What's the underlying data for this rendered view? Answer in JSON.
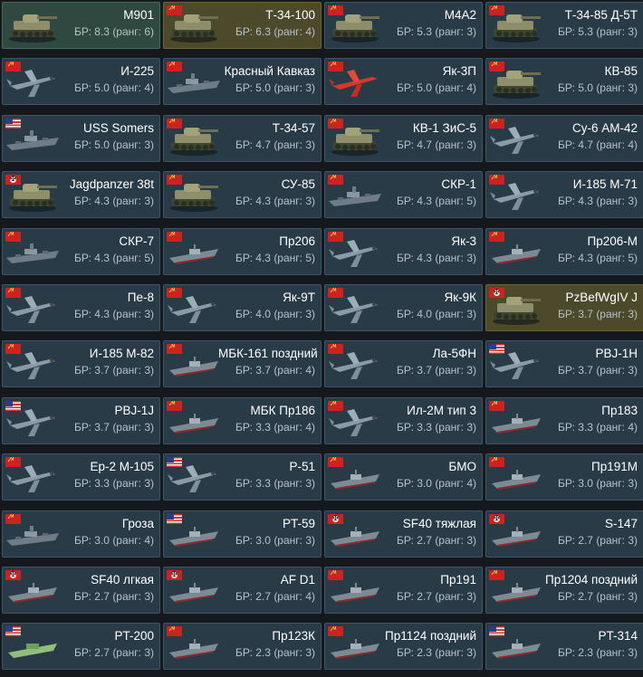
{
  "colors": {
    "normal": "#2a3b48",
    "premium": "#4d4a2b",
    "collectible": "#2f4840"
  },
  "vehicles": [
    {
      "name": "M901",
      "br": "БР: 8.3 (ранг: 6)",
      "nation": "none",
      "type": "tank",
      "variant": "collect",
      "icon": "tank-icon"
    },
    {
      "name": "Т-34-100",
      "br": "БР: 6.3 (ранг: 4)",
      "nation": "ussr",
      "type": "tank",
      "variant": "premium",
      "icon": "tank-icon"
    },
    {
      "name": "M4A2",
      "br": "БР: 5.3 (ранг: 3)",
      "nation": "ussr",
      "type": "tank",
      "variant": "normal",
      "icon": "tank-icon"
    },
    {
      "name": "Т-34-85 Д-5Т",
      "br": "БР: 5.3 (ранг: 3)",
      "nation": "ussr",
      "type": "tank",
      "variant": "normal",
      "icon": "tank-icon"
    },
    {
      "name": "И-225",
      "br": "БР: 5.0 (ранг: 4)",
      "nation": "ussr",
      "type": "plane",
      "variant": "normal",
      "icon": "plane-icon"
    },
    {
      "name": "Красный Кавказ",
      "br": "БР: 5.0 (ранг: 3)",
      "nation": "ussr",
      "type": "ship",
      "variant": "normal",
      "icon": "ship-icon"
    },
    {
      "name": "Як-3П",
      "br": "БР: 5.0 (ранг: 4)",
      "nation": "ussr",
      "type": "plane-red",
      "variant": "normal",
      "icon": "plane-icon"
    },
    {
      "name": "КВ-85",
      "br": "БР: 5.0 (ранг: 3)",
      "nation": "ussr",
      "type": "tank",
      "variant": "normal",
      "icon": "tank-icon"
    },
    {
      "name": "USS Somers",
      "br": "БР: 5.0 (ранг: 3)",
      "nation": "usa",
      "type": "ship",
      "variant": "normal",
      "icon": "ship-icon"
    },
    {
      "name": "Т-34-57",
      "br": "БР: 4.7 (ранг: 3)",
      "nation": "ussr",
      "type": "tank",
      "variant": "normal",
      "icon": "tank-icon"
    },
    {
      "name": "КВ-1 ЗиС-5",
      "br": "БР: 4.7 (ранг: 3)",
      "nation": "ussr",
      "type": "tank",
      "variant": "normal",
      "icon": "tank-icon"
    },
    {
      "name": "Су-6 АМ-42",
      "br": "БР: 4.7 (ранг: 4)",
      "nation": "ussr",
      "type": "plane",
      "variant": "normal",
      "icon": "plane-icon"
    },
    {
      "name": "Jagdpanzer 38t",
      "br": "БР: 4.3 (ранг: 3)",
      "nation": "ger",
      "type": "tank",
      "variant": "normal",
      "icon": "tank-icon"
    },
    {
      "name": "СУ-85",
      "br": "БР: 4.3 (ранг: 3)",
      "nation": "ussr",
      "type": "tank",
      "variant": "normal",
      "icon": "tank-icon"
    },
    {
      "name": "СКР-1",
      "br": "БР: 4.3 (ранг: 5)",
      "nation": "ussr",
      "type": "ship",
      "variant": "normal",
      "icon": "ship-icon"
    },
    {
      "name": "И-185 М-71",
      "br": "БР: 4.3 (ранг: 3)",
      "nation": "ussr",
      "type": "plane",
      "variant": "normal",
      "icon": "plane-icon"
    },
    {
      "name": "СКР-7",
      "br": "БР: 4.3 (ранг: 5)",
      "nation": "ussr",
      "type": "ship",
      "variant": "normal",
      "icon": "ship-icon"
    },
    {
      "name": "Пр206",
      "br": "БР: 4.3 (ранг: 5)",
      "nation": "ussr",
      "type": "boat",
      "variant": "normal",
      "icon": "boat-icon"
    },
    {
      "name": "Як-3",
      "br": "БР: 4.3 (ранг: 3)",
      "nation": "ussr",
      "type": "plane",
      "variant": "normal",
      "icon": "plane-icon"
    },
    {
      "name": "Пр206-М",
      "br": "БР: 4.3 (ранг: 5)",
      "nation": "ussr",
      "type": "boat",
      "variant": "normal",
      "icon": "boat-icon"
    },
    {
      "name": "Пе-8",
      "br": "БР: 4.3 (ранг: 3)",
      "nation": "ussr",
      "type": "plane",
      "variant": "normal",
      "icon": "plane-icon"
    },
    {
      "name": "Як-9Т",
      "br": "БР: 4.0 (ранг: 3)",
      "nation": "ussr",
      "type": "plane",
      "variant": "normal",
      "icon": "plane-icon"
    },
    {
      "name": "Як-9К",
      "br": "БР: 4.0 (ранг: 3)",
      "nation": "ussr",
      "type": "plane",
      "variant": "normal",
      "icon": "plane-icon"
    },
    {
      "name": "PzBefWgIV J",
      "br": "БР: 3.7 (ранг: 3)",
      "nation": "ger",
      "type": "tank",
      "variant": "premium",
      "icon": "tank-icon"
    },
    {
      "name": "И-185 М-82",
      "br": "БР: 3.7 (ранг: 3)",
      "nation": "ussr",
      "type": "plane",
      "variant": "normal",
      "icon": "plane-icon"
    },
    {
      "name": "МБК-161 поздний",
      "br": "БР: 3.7 (ранг: 4)",
      "nation": "ussr",
      "type": "boat",
      "variant": "normal",
      "icon": "boat-icon"
    },
    {
      "name": "Ла-5ФН",
      "br": "БР: 3.7 (ранг: 3)",
      "nation": "ussr",
      "type": "plane",
      "variant": "normal",
      "icon": "plane-icon"
    },
    {
      "name": "PBJ-1H",
      "br": "БР: 3.7 (ранг: 3)",
      "nation": "usa",
      "type": "plane",
      "variant": "normal",
      "icon": "plane-icon"
    },
    {
      "name": "PBJ-1J",
      "br": "БР: 3.7 (ранг: 3)",
      "nation": "usa",
      "type": "plane",
      "variant": "normal",
      "icon": "plane-icon"
    },
    {
      "name": "МБК Пр186",
      "br": "БР: 3.3 (ранг: 4)",
      "nation": "ussr",
      "type": "boat",
      "variant": "normal",
      "icon": "boat-icon"
    },
    {
      "name": "Ил-2М тип 3",
      "br": "БР: 3.3 (ранг: 3)",
      "nation": "ussr",
      "type": "plane",
      "variant": "normal",
      "icon": "plane-icon"
    },
    {
      "name": "Пр183",
      "br": "БР: 3.3 (ранг: 4)",
      "nation": "ussr",
      "type": "boat",
      "variant": "normal",
      "icon": "boat-icon"
    },
    {
      "name": "Ер-2 М-105",
      "br": "БР: 3.3 (ранг: 3)",
      "nation": "ussr",
      "type": "plane",
      "variant": "normal",
      "icon": "plane-icon"
    },
    {
      "name": "P-51",
      "br": "БР: 3.3 (ранг: 3)",
      "nation": "usa",
      "type": "plane",
      "variant": "normal",
      "icon": "plane-icon"
    },
    {
      "name": "БМО",
      "br": "БР: 3.0 (ранг: 4)",
      "nation": "ussr",
      "type": "boat",
      "variant": "normal",
      "icon": "boat-icon"
    },
    {
      "name": "Пр191М",
      "br": "БР: 3.0 (ранг: 3)",
      "nation": "ussr",
      "type": "boat",
      "variant": "normal",
      "icon": "boat-icon"
    },
    {
      "name": "Гроза",
      "br": "БР: 3.0 (ранг: 4)",
      "nation": "ussr",
      "type": "ship",
      "variant": "normal",
      "icon": "ship-icon"
    },
    {
      "name": "PT-59",
      "br": "БР: 3.0 (ранг: 3)",
      "nation": "usa",
      "type": "boat",
      "variant": "normal",
      "icon": "boat-icon"
    },
    {
      "name": "SF40 тяжлая",
      "br": "БР: 2.7 (ранг: 3)",
      "nation": "ger",
      "type": "boat",
      "variant": "normal",
      "icon": "boat-icon"
    },
    {
      "name": "S-147",
      "br": "БР: 2.7 (ранг: 3)",
      "nation": "ger",
      "type": "boat",
      "variant": "normal",
      "icon": "boat-icon"
    },
    {
      "name": "SF40 лгкая",
      "br": "БР: 2.7 (ранг: 3)",
      "nation": "ger",
      "type": "boat",
      "variant": "normal",
      "icon": "boat-icon"
    },
    {
      "name": "AF D1",
      "br": "БР: 2.7 (ранг: 4)",
      "nation": "ger",
      "type": "boat",
      "variant": "normal",
      "icon": "boat-icon"
    },
    {
      "name": "Пр191",
      "br": "БР: 2.7 (ранг: 3)",
      "nation": "ussr",
      "type": "boat",
      "variant": "normal",
      "icon": "boat-icon"
    },
    {
      "name": "Пр1204 поздний",
      "br": "БР: 2.7 (ранг: 3)",
      "nation": "ussr",
      "type": "boat",
      "variant": "normal",
      "icon": "boat-icon"
    },
    {
      "name": "PT-200",
      "br": "БР: 2.7 (ранг: 3)",
      "nation": "usa",
      "type": "boat-green",
      "variant": "normal",
      "icon": "boat-icon"
    },
    {
      "name": "Пр123К",
      "br": "БР: 2.3 (ранг: 3)",
      "nation": "ussr",
      "type": "boat",
      "variant": "normal",
      "icon": "boat-icon"
    },
    {
      "name": "Пр1124 поздний",
      "br": "БР: 2.3 (ранг: 3)",
      "nation": "ussr",
      "type": "boat",
      "variant": "normal",
      "icon": "boat-icon"
    },
    {
      "name": "PT-314",
      "br": "БР: 2.3 (ранг: 3)",
      "nation": "usa",
      "type": "boat",
      "variant": "normal",
      "icon": "boat-icon"
    }
  ]
}
